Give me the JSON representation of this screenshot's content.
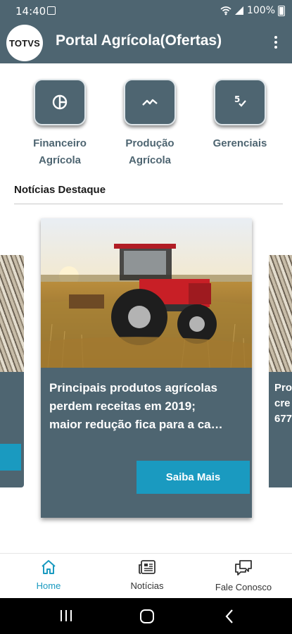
{
  "status_bar": {
    "time": "14:40",
    "battery": "100%"
  },
  "app_bar": {
    "logo_text": "TOTVS",
    "title": "Portal Agrícola(Ofertas)"
  },
  "quick_actions": [
    {
      "line1": "Financeiro",
      "line2": "Agrícola",
      "icon": "pie-chart-icon"
    },
    {
      "line1": "Produção",
      "line2": "Agrícola",
      "icon": "trend-icon"
    },
    {
      "line1": "Gerenciais",
      "line2": "",
      "icon": "checklist-icon"
    }
  ],
  "section": {
    "title": "Notícias Destaque"
  },
  "news": {
    "main": {
      "title_lines": [
        "Principais produtos agrícolas",
        "perdem receitas em 2019;",
        "maior redução fica para a ca…"
      ],
      "button": "Saiba Mais"
    },
    "right_peek_lines": [
      "Pro",
      "cre",
      "677"
    ]
  },
  "bottom_nav": [
    {
      "label": "Home",
      "icon": "home-icon",
      "active": true
    },
    {
      "label": "Notícias",
      "icon": "news-icon",
      "active": false
    },
    {
      "label": "Fale Conosco",
      "icon": "chat-icon",
      "active": false
    }
  ],
  "colors": {
    "primary": "#4e6571",
    "accent": "#1a9ac0",
    "active_nav": "#1a9ac0"
  }
}
